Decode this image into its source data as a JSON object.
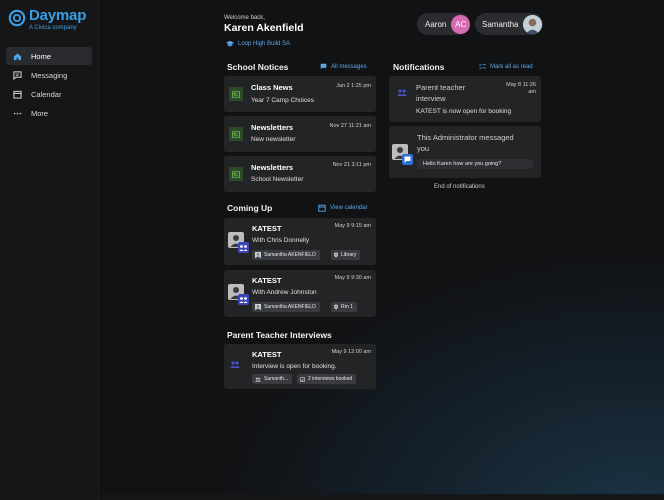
{
  "brand": {
    "name": "Daymap",
    "tagline": "A Civica company"
  },
  "nav": [
    {
      "label": "Home",
      "icon": "home-icon",
      "active": true
    },
    {
      "label": "Messaging",
      "icon": "message-icon",
      "active": false
    },
    {
      "label": "Calendar",
      "icon": "calendar-icon",
      "active": false
    },
    {
      "label": "More",
      "icon": "more-icon",
      "active": false
    }
  ],
  "header": {
    "welcome": "Welcome back,",
    "name": "Karen Akenfield",
    "school": "Loop High Build SA",
    "users": [
      {
        "name": "Aaron",
        "initials": "AC"
      },
      {
        "name": "Samantha"
      }
    ]
  },
  "notices": {
    "title": "School Notices",
    "link": "All messages",
    "items": [
      {
        "title": "Class News",
        "subtitle": "Year 7 Camp Choices",
        "date": "Jan 2 1:25 pm"
      },
      {
        "title": "Newsletters",
        "subtitle": "New newsletter",
        "date": "Nov 27 11:21 am"
      },
      {
        "title": "Newsletters",
        "subtitle": "School Newsletter",
        "date": "Nov 21 3:11 pm"
      }
    ]
  },
  "coming_up": {
    "title": "Coming Up",
    "link": "View calendar",
    "items": [
      {
        "title": "KATEST",
        "subtitle": "With Chris Donnelly",
        "date": "May 9 9:15 am",
        "person": "Samantha AKENFIELD",
        "location": "Library"
      },
      {
        "title": "KATEST",
        "subtitle": "With Andrew Johnston",
        "date": "May 9 9:30 am",
        "person": "Samantha AKENFIELD",
        "location": "Rm 1"
      }
    ]
  },
  "interviews": {
    "title": "Parent Teacher Interviews",
    "item": {
      "title": "KATEST",
      "subtitle": "Interview is open for booking.",
      "date": "May 9 12:00 am",
      "person": "Samanth...",
      "booked": "2 interviews booked"
    }
  },
  "notifications": {
    "title": "Notifications",
    "link": "Mark all as read",
    "items": [
      {
        "title_line1": "Parent teacher",
        "title_line2": "interview",
        "subtitle": "KATEST is now open for booking",
        "date_line1": "May 8 11:26",
        "date_line2": "am"
      },
      {
        "title_line1": "This Administrator messaged",
        "title_line2": "you",
        "message": "Hello Karen how are you going?"
      }
    ],
    "end": "End of notifications"
  },
  "colors": {
    "accent": "#5aa9ee",
    "brand": "#3aa0e6",
    "avatar": "#d76bb0",
    "card": "#232426"
  }
}
